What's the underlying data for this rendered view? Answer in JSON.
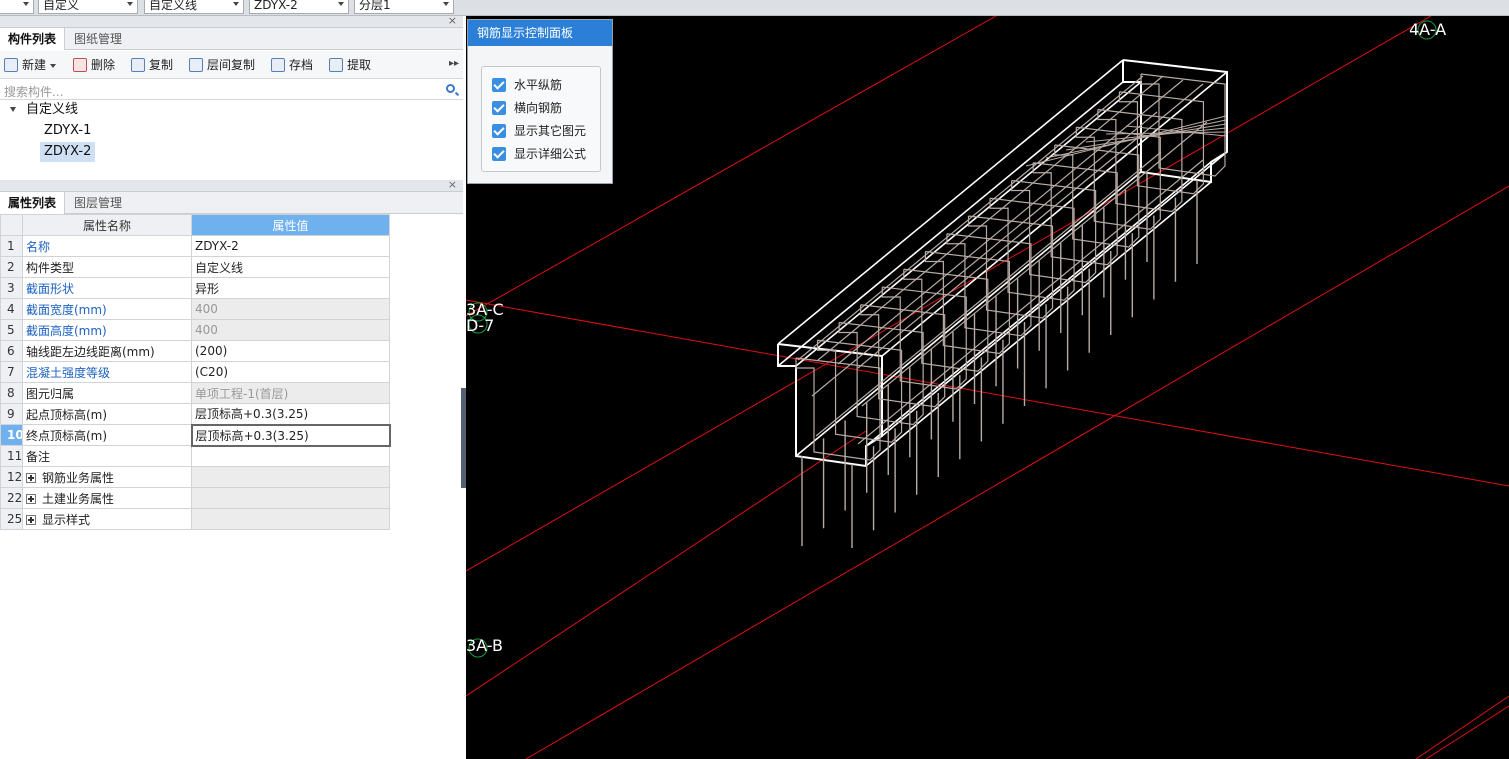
{
  "topbar": {
    "combos": [
      "自定义",
      "自定义线",
      "ZDYX-2",
      "分层1"
    ]
  },
  "component_panel": {
    "tabs": [
      "构件列表",
      "图纸管理"
    ],
    "toolbar": {
      "new": "新建",
      "delete": "删除",
      "copy": "复制",
      "floor_copy": "层间复制",
      "save": "存档",
      "extract": "提取"
    },
    "search_placeholder": "搜索构件...",
    "tree": {
      "root": "自定义线",
      "children": [
        "ZDYX-1",
        "ZDYX-2"
      ],
      "selected": "ZDYX-2"
    }
  },
  "property_panel": {
    "tabs": [
      "属性列表",
      "图层管理"
    ],
    "headers": [
      "属性名称",
      "属性值"
    ],
    "rows": [
      {
        "num": "1",
        "name": "名称",
        "value": "ZDYX-2"
      },
      {
        "num": "2",
        "name": "构件类型",
        "value": "自定义线"
      },
      {
        "num": "3",
        "name": "截面形状",
        "value": "异形"
      },
      {
        "num": "4",
        "name": "截面宽度(mm)",
        "value": "400"
      },
      {
        "num": "5",
        "name": "截面高度(mm)",
        "value": "400"
      },
      {
        "num": "6",
        "name": "轴线距左边线距离(mm)",
        "value": "(200)"
      },
      {
        "num": "7",
        "name": "混凝土强度等级",
        "value": "(C20)"
      },
      {
        "num": "8",
        "name": "图元归属",
        "value": "单项工程-1(首层)"
      },
      {
        "num": "9",
        "name": "起点顶标高(m)",
        "value": "层顶标高+0.3(3.25)"
      },
      {
        "num": "10",
        "name": "终点顶标高(m)",
        "value": "层顶标高+0.3(3.25)"
      },
      {
        "num": "11",
        "name": "备注",
        "value": ""
      },
      {
        "num": "12",
        "name": "钢筋业务属性",
        "value": ""
      },
      {
        "num": "22",
        "name": "土建业务属性",
        "value": ""
      },
      {
        "num": "25",
        "name": "显示样式",
        "value": ""
      }
    ]
  },
  "control_panel": {
    "title": "钢筋显示控制面板",
    "options": [
      {
        "label": "水平纵筋",
        "checked": true
      },
      {
        "label": "横向钢筋",
        "checked": true
      },
      {
        "label": "显示其它图元",
        "checked": true
      },
      {
        "label": "显示详细公式",
        "checked": true
      }
    ]
  },
  "viewport": {
    "axis_labels": [
      "4A-A",
      "3A-C",
      "D-7",
      "3A-B"
    ],
    "colors": {
      "background": "#000000",
      "axis": "#e01010",
      "concrete": "#ffffff",
      "rebar": "#b8aba4"
    }
  }
}
